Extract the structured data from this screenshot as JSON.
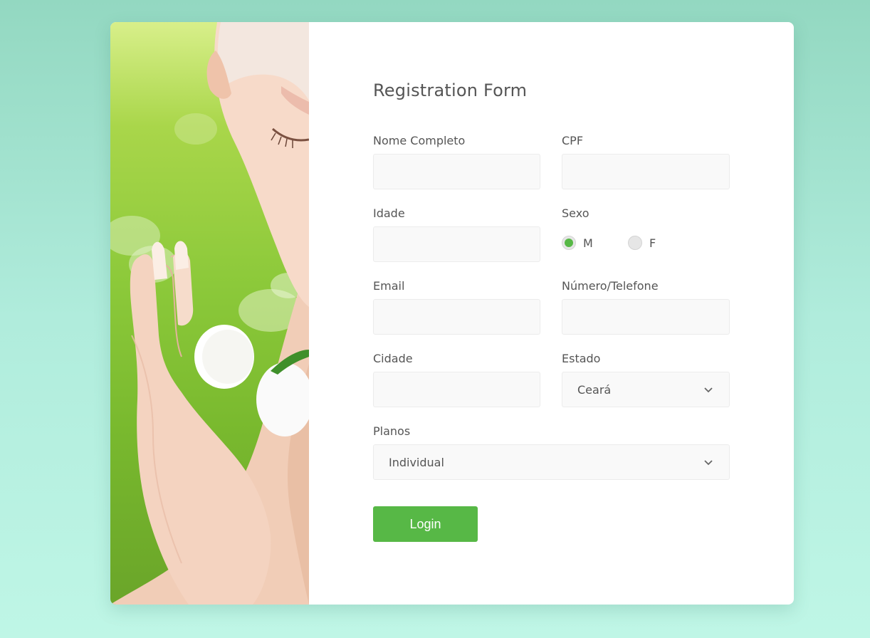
{
  "form": {
    "title": "Registration Form",
    "fields": {
      "nome": {
        "label": "Nome Completo",
        "value": ""
      },
      "cpf": {
        "label": "CPF",
        "value": ""
      },
      "idade": {
        "label": "Idade",
        "value": ""
      },
      "sexo": {
        "label": "Sexo",
        "options": [
          "M",
          "F"
        ],
        "selected": "M"
      },
      "email": {
        "label": "Email",
        "value": ""
      },
      "telefone": {
        "label": "Número/Telefone",
        "value": ""
      },
      "cidade": {
        "label": "Cidade",
        "value": ""
      },
      "estado": {
        "label": "Estado",
        "selected": "Ceará"
      },
      "planos": {
        "label": "Planos",
        "selected": "Individual"
      }
    },
    "submit_label": "Login"
  },
  "colors": {
    "accent": "#57b846",
    "text": "#555555",
    "input_bg": "#f9f9f9",
    "page_bg_top": "#93d8c1",
    "page_bg_bottom": "#bff6e6"
  },
  "icons": [
    "chevron-down-icon"
  ]
}
